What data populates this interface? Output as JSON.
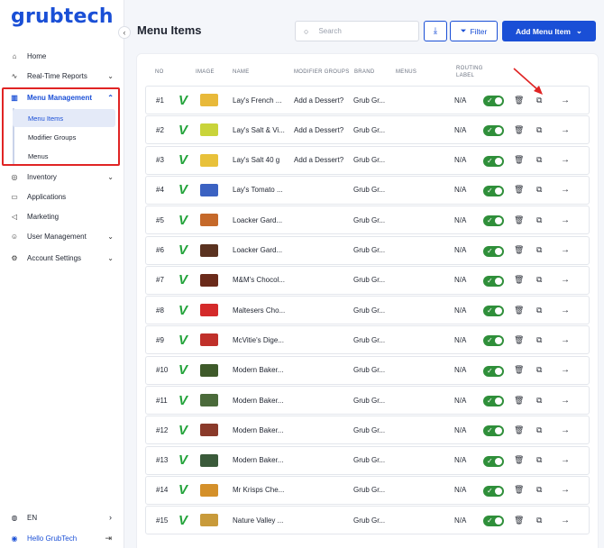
{
  "sidebar": {
    "logo": "grubtech",
    "collapse_icon": "‹",
    "items": [
      {
        "icon": "⌂",
        "label": "Home",
        "chevron": ""
      },
      {
        "icon": "∿",
        "label": "Real-Time Reports",
        "chevron": "⌄"
      },
      {
        "icon": "▥",
        "label": "Menu Management",
        "chevron": "⌃"
      },
      {
        "icon": "◎",
        "label": "Inventory",
        "chevron": "⌄"
      },
      {
        "icon": "▭",
        "label": "Applications",
        "chevron": ""
      },
      {
        "icon": "◁",
        "label": "Marketing",
        "chevron": ""
      },
      {
        "icon": "☺",
        "label": "User Management",
        "chevron": "⌄"
      },
      {
        "icon": "⚙",
        "label": "Account Settings",
        "chevron": "⌄"
      }
    ],
    "sub_items": [
      "Menu Items",
      "Modifier Groups",
      "Menus"
    ],
    "language": {
      "icon": "◍",
      "label": "EN",
      "chevron": "›"
    },
    "user": {
      "icon": "◉",
      "label": "Hello GrubTech",
      "logout_icon": "⇥"
    }
  },
  "header": {
    "title": "Menu Items",
    "search_placeholder": "Search",
    "search_icon": "○",
    "download_icon": "⤓",
    "filter_icon": "⏷",
    "filter_label": "Filter",
    "add_label": "Add Menu Item",
    "add_chevron": "⌄"
  },
  "table": {
    "columns": [
      "NO",
      "IMAGE",
      "NAME",
      "MODIFIER GROUPS",
      "BRAND",
      "MENUS",
      "ROUTING LABEL"
    ],
    "veg_icon": "V",
    "toggle_check": "✓",
    "trash_icon": "🗑",
    "copy_icon": "⧉",
    "arrow_icon": "→",
    "rows": [
      {
        "no": "#1",
        "name": "Lay's French ...",
        "modifier": "Add a Dessert?",
        "brand": "Grub Gr...",
        "routing": "N/A",
        "thumb": "#e8b93a"
      },
      {
        "no": "#2",
        "name": "Lay's Salt & Vi...",
        "modifier": "Add a Dessert?",
        "brand": "Grub Gr...",
        "routing": "N/A",
        "thumb": "#c9d43a"
      },
      {
        "no": "#3",
        "name": "Lay's Salt 40 g",
        "modifier": "Add a Dessert?",
        "brand": "Grub Gr...",
        "routing": "N/A",
        "thumb": "#e8c13a"
      },
      {
        "no": "#4",
        "name": "Lay's Tomato ...",
        "modifier": "",
        "brand": "Grub Gr...",
        "routing": "N/A",
        "thumb": "#3b62c2"
      },
      {
        "no": "#5",
        "name": "Loacker Gard...",
        "modifier": "",
        "brand": "Grub Gr...",
        "routing": "N/A",
        "thumb": "#c5692a"
      },
      {
        "no": "#6",
        "name": "Loacker Gard...",
        "modifier": "",
        "brand": "Grub Gr...",
        "routing": "N/A",
        "thumb": "#5a3220"
      },
      {
        "no": "#7",
        "name": "M&M's Chocol...",
        "modifier": "",
        "brand": "Grub Gr...",
        "routing": "N/A",
        "thumb": "#6a2a1a"
      },
      {
        "no": "#8",
        "name": "Maltesers Cho...",
        "modifier": "",
        "brand": "Grub Gr...",
        "routing": "N/A",
        "thumb": "#d42a2a"
      },
      {
        "no": "#9",
        "name": "McVitie's Dige...",
        "modifier": "",
        "brand": "Grub Gr...",
        "routing": "N/A",
        "thumb": "#c0302a"
      },
      {
        "no": "#10",
        "name": "Modern Baker...",
        "modifier": "",
        "brand": "Grub Gr...",
        "routing": "N/A",
        "thumb": "#3e5a2a"
      },
      {
        "no": "#11",
        "name": "Modern Baker...",
        "modifier": "",
        "brand": "Grub Gr...",
        "routing": "N/A",
        "thumb": "#4a6a3a"
      },
      {
        "no": "#12",
        "name": "Modern Baker...",
        "modifier": "",
        "brand": "Grub Gr...",
        "routing": "N/A",
        "thumb": "#8a3a2a"
      },
      {
        "no": "#13",
        "name": "Modern Baker...",
        "modifier": "",
        "brand": "Grub Gr...",
        "routing": "N/A",
        "thumb": "#3a5a3a"
      },
      {
        "no": "#14",
        "name": "Mr Krisps Che...",
        "modifier": "",
        "brand": "Grub Gr...",
        "routing": "N/A",
        "thumb": "#d4902a"
      },
      {
        "no": "#15",
        "name": "Nature Valley ...",
        "modifier": "",
        "brand": "Grub Gr...",
        "routing": "N/A",
        "thumb": "#c89a3a"
      }
    ]
  },
  "colors": {
    "accent": "#1a4fd6",
    "toggle_on": "#2f8f3a",
    "highlight": "#e02424",
    "veg": "#22a33a"
  }
}
